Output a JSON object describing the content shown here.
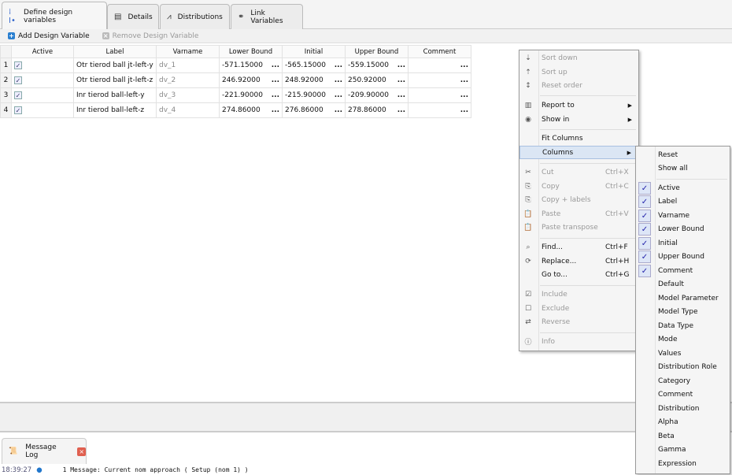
{
  "tabs": [
    {
      "label": "Define design variables",
      "icon": "design-variables-icon"
    },
    {
      "label": "Details",
      "icon": "table-icon"
    },
    {
      "label": "Distributions",
      "icon": "distribution-icon"
    },
    {
      "label": "Link Variables",
      "icon": "link-variables-icon"
    }
  ],
  "toolbar": {
    "add": "Add Design Variable",
    "remove": "Remove Design Variable"
  },
  "table": {
    "headers": [
      "Active",
      "Label",
      "Varname",
      "Lower Bound",
      "Initial",
      "Upper Bound",
      "Comment"
    ],
    "rows": [
      {
        "n": "1",
        "active": true,
        "label": "Otr tierod ball jt-left-y",
        "varname": "dv_1",
        "lower": "-571.15000",
        "initial": "-565.15000",
        "upper": "-559.15000",
        "comment": ""
      },
      {
        "n": "2",
        "active": true,
        "label": "Otr tierod ball jt-left-z",
        "varname": "dv_2",
        "lower": "246.92000",
        "initial": "248.92000",
        "upper": "250.92000",
        "comment": ""
      },
      {
        "n": "3",
        "active": true,
        "label": "Inr tierod ball-left-y",
        "varname": "dv_3",
        "lower": "-221.90000",
        "initial": "-215.90000",
        "upper": "-209.90000",
        "comment": ""
      },
      {
        "n": "4",
        "active": true,
        "label": "Inr tierod ball-left-z",
        "varname": "dv_4",
        "lower": "274.86000",
        "initial": "276.86000",
        "upper": "278.86000",
        "comment": ""
      }
    ],
    "ellipsis": "..."
  },
  "context_menu": [
    {
      "label": "Sort down",
      "disabled": true,
      "icon": "sort-down-icon"
    },
    {
      "label": "Sort up",
      "disabled": true,
      "icon": "sort-up-icon"
    },
    {
      "label": "Reset order",
      "disabled": true,
      "icon": "reset-order-icon"
    },
    {
      "label": "Report to",
      "submenu": true,
      "icon": "report-icon"
    },
    {
      "label": "Show in",
      "submenu": true,
      "icon": "eye-icon"
    },
    {
      "label": "Fit Columns"
    },
    {
      "label": "Columns",
      "submenu": true,
      "highlighted": true
    },
    {
      "label": "Cut",
      "shortcut": "Ctrl+X",
      "disabled": true,
      "icon": "cut-icon"
    },
    {
      "label": "Copy",
      "shortcut": "Ctrl+C",
      "disabled": true,
      "icon": "copy-icon"
    },
    {
      "label": "Copy + labels",
      "disabled": true,
      "icon": "copy-labels-icon"
    },
    {
      "label": "Paste",
      "shortcut": "Ctrl+V",
      "disabled": true,
      "icon": "paste-icon"
    },
    {
      "label": "Paste transpose",
      "disabled": true,
      "icon": "paste-transpose-icon"
    },
    {
      "label": "Find...",
      "shortcut": "Ctrl+F",
      "icon": "search-icon"
    },
    {
      "label": "Replace...",
      "shortcut": "Ctrl+H",
      "icon": "replace-icon"
    },
    {
      "label": "Go to...",
      "shortcut": "Ctrl+G"
    },
    {
      "label": "Include",
      "disabled": true,
      "icon": "include-icon"
    },
    {
      "label": "Exclude",
      "disabled": true,
      "icon": "exclude-icon"
    },
    {
      "label": "Reverse",
      "disabled": true,
      "icon": "reverse-icon"
    },
    {
      "label": "Info",
      "disabled": true,
      "icon": "info-icon"
    }
  ],
  "columns_submenu": [
    {
      "label": "Reset"
    },
    {
      "label": "Show all"
    },
    {
      "label": "Active",
      "checked": true
    },
    {
      "label": "Label",
      "checked": true
    },
    {
      "label": "Varname",
      "checked": true
    },
    {
      "label": "Lower Bound",
      "checked": true
    },
    {
      "label": "Initial",
      "checked": true
    },
    {
      "label": "Upper Bound",
      "checked": true
    },
    {
      "label": "Comment",
      "checked": true
    },
    {
      "label": "Default"
    },
    {
      "label": "Model Parameter"
    },
    {
      "label": "Model Type"
    },
    {
      "label": "Data Type"
    },
    {
      "label": "Mode"
    },
    {
      "label": "Values"
    },
    {
      "label": "Distribution Role"
    },
    {
      "label": "Category"
    },
    {
      "label": "Comment"
    },
    {
      "label": "Distribution"
    },
    {
      "label": "Alpha"
    },
    {
      "label": "Beta"
    },
    {
      "label": "Gamma"
    },
    {
      "label": "Expression"
    }
  ],
  "log": {
    "tab": "Message Log",
    "time": "18:39:27",
    "message": "1 Message: Current nom approach ( Setup (nom 1) )"
  }
}
